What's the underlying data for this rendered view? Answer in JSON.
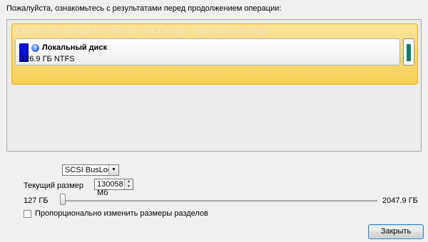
{
  "instruction": "Пожалуйста, ознакомьтесь с результатами перед продолжением операции:",
  "disk": {
    "title": "Базовый жесткий диск 3 (VMware virtual image) - Виртуальный образ",
    "partition": {
      "name": "Локальный диск",
      "info": "126.9 ГБ NTFS",
      "icon": "drive-question-icon",
      "color": "#0a10d8"
    },
    "unallocated_color": "#0c7a70",
    "highlight_color": "#f7cf57"
  },
  "controller": {
    "selected": "SCSI BusLogic"
  },
  "size": {
    "label": "Текущий размер",
    "value": "130058 Мб"
  },
  "slider": {
    "min_label": "127 ГБ",
    "max_label": "2047.9 ГБ",
    "position_fraction": 0.0
  },
  "proportional_checkbox": {
    "label": "Пропорционально изменить размеры разделов",
    "checked": false
  },
  "buttons": {
    "close": "Закрыть"
  }
}
